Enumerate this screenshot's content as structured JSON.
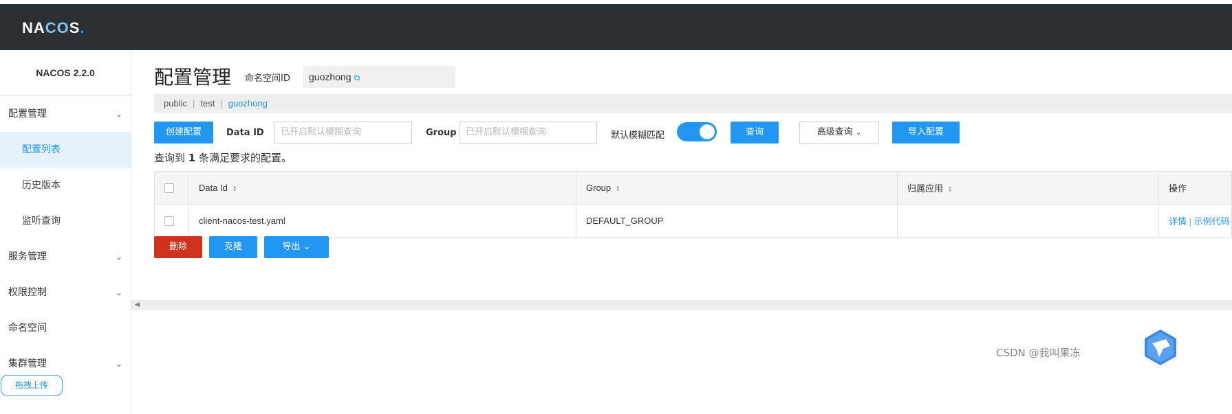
{
  "header": {
    "logo_prefix": "NA",
    "logo_oo": "CO",
    "logo_suffix": "S",
    "logo_dot": "."
  },
  "sidebar": {
    "version": "NACOS 2.2.0",
    "groups": [
      {
        "label": "配置管理",
        "items": [
          "配置列表",
          "历史版本",
          "监听查询"
        ]
      },
      {
        "label": "服务管理"
      },
      {
        "label": "权限控制"
      },
      {
        "label": "命名空间"
      },
      {
        "label": "集群管理"
      }
    ],
    "upload_label": "拖拽上传"
  },
  "main": {
    "title": "配置管理",
    "namespace_label": "命名空间ID",
    "namespace_value": "guozhong",
    "ns_tabs": [
      "public",
      "test",
      "guozhong"
    ],
    "create_btn": "创建配置",
    "data_id_label": "Data ID",
    "data_id_placeholder": "已开启默认模糊查询",
    "group_label": "Group",
    "group_placeholder": "已开启默认模糊查询",
    "fuzzy_label": "默认模糊匹配",
    "fuzzy_on": true,
    "query_btn": "查询",
    "advanced_btn": "高级查询",
    "import_btn": "导入配置",
    "result_prefix": "查询到",
    "result_count": "1",
    "result_suffix": "条满足要求的配置。",
    "table": {
      "headers": [
        "Data Id",
        "Group",
        "归属应用",
        "操作"
      ],
      "rows": [
        {
          "data_id": "client-nacos-test.yaml",
          "group": "DEFAULT_GROUP",
          "app": "",
          "op_detail": "详情",
          "op_sample": "示例代码"
        }
      ]
    },
    "delete_btn": "删除",
    "clone_btn": "克隆",
    "export_btn": "导出"
  },
  "watermark": "CSDN @我叫果冻",
  "colors": {
    "primary": "#2196f3",
    "danger": "#d0321e",
    "topbar": "#2b3035"
  }
}
